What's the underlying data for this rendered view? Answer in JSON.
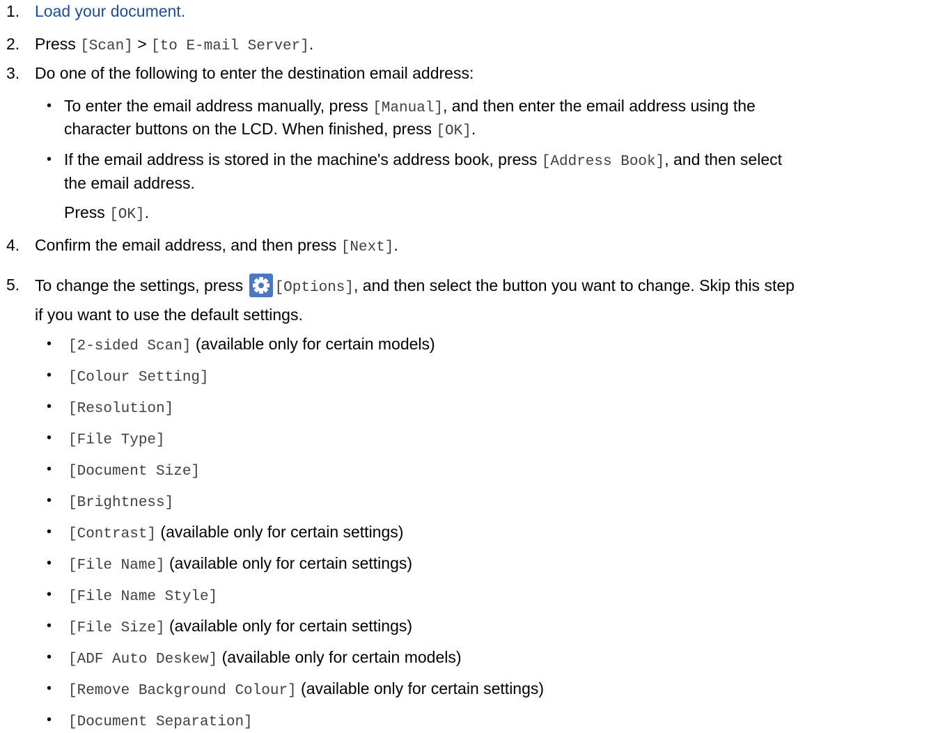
{
  "steps": [
    {
      "num": "1.",
      "link": "Load your document."
    },
    {
      "num": "2.",
      "pre": "Press ",
      "code1": "[Scan]",
      "mid": " > ",
      "code2": "[to E-mail Server]",
      "post": "."
    },
    {
      "num": "3.",
      "text": "Do one of the following to enter the destination email address:"
    },
    {
      "num": "4.",
      "pre": "Confirm the email address, and then press ",
      "code1": "[Next]",
      "post": "."
    },
    {
      "num": "5.",
      "pre": "To change the settings, press ",
      "code1": "[Options]",
      "post": ", and then select the button you want to change. Skip this step",
      "line2": "if you want to use the default settings."
    }
  ],
  "step3_bullets": {
    "b1": {
      "pre": "To enter the email address manually, press ",
      "code": "[Manual]",
      "post": ", and then enter the email address using the",
      "line2_pre": "character buttons on the LCD. When finished, press ",
      "line2_code": "[OK]",
      "line2_post": "."
    },
    "b2": {
      "pre": "If the email address is stored in the machine's address book, press ",
      "code": "[Address Book]",
      "post": ", and then select",
      "line2": "the email address."
    },
    "press_pre": "Press ",
    "press_code": "[OK]",
    "press_post": "."
  },
  "bullet_char": "•",
  "gear_icon": "gear-icon",
  "options": [
    {
      "code": "[2-sided Scan]",
      "note": "(available only for certain models)"
    },
    {
      "code": "[Colour Setting]",
      "note": ""
    },
    {
      "code": "[Resolution]",
      "note": ""
    },
    {
      "code": "[File Type]",
      "note": ""
    },
    {
      "code": "[Document Size]",
      "note": ""
    },
    {
      "code": "[Brightness]",
      "note": ""
    },
    {
      "code": "[Contrast]",
      "note": "(available only for certain settings)"
    },
    {
      "code": "[File Name]",
      "note": "(available only for certain settings)"
    },
    {
      "code": "[File Name Style]",
      "note": ""
    },
    {
      "code": "[File Size]",
      "note": "(available only for certain settings)"
    },
    {
      "code": "[ADF Auto Deskew]",
      "note": "(available only for certain models)"
    },
    {
      "code": "[Remove Background Colour]",
      "note": "(available only for certain settings)"
    },
    {
      "code": "[Document Separation]",
      "note": ""
    }
  ]
}
